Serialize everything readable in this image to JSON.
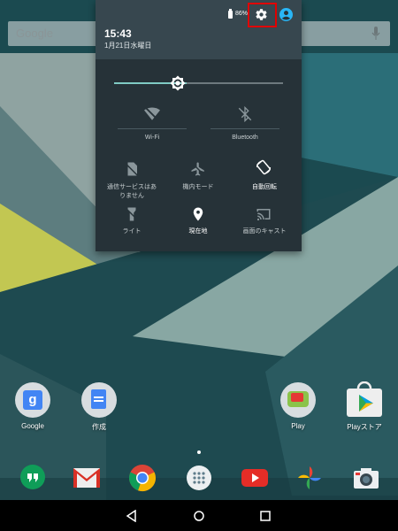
{
  "search": {
    "logo": "Google",
    "icons": {
      "mic": "microphone-icon"
    }
  },
  "status": {
    "battery_pct": "86%",
    "icons": {
      "battery": "battery-icon",
      "settings": "gear-icon",
      "user": "account-icon"
    }
  },
  "shade": {
    "time": "15:43",
    "date": "1月21日水曜日",
    "brightness_fraction": 0.43,
    "tiles": [
      {
        "label": "Wi-Fi",
        "icon": "wifi-off-icon"
      },
      {
        "label": "Bluetooth",
        "icon": "bluetooth-off-icon"
      },
      {
        "label_line1": "通信サービスはあ",
        "label_line2": "りません",
        "icon": "no-sim-icon"
      },
      {
        "label": "機内モード",
        "icon": "airplane-icon"
      },
      {
        "label": "自動回転",
        "icon": "auto-rotate-icon"
      },
      {
        "label": "ライト",
        "icon": "flashlight-icon"
      },
      {
        "label": "現在地",
        "icon": "location-icon"
      },
      {
        "label": "画面のキャスト",
        "icon": "cast-icon"
      }
    ]
  },
  "home": {
    "apps": [
      {
        "label": "Google",
        "icon": "google-folder-icon"
      },
      {
        "label": "作成",
        "icon": "docs-folder-icon"
      },
      {
        "label": "Play",
        "icon": "play-folder-icon"
      },
      {
        "label": "Playストア",
        "icon": "play-store-icon"
      }
    ],
    "dock": [
      {
        "icon": "hangouts-icon"
      },
      {
        "icon": "gmail-icon"
      },
      {
        "icon": "chrome-icon"
      },
      {
        "icon": "app-drawer-icon"
      },
      {
        "icon": "youtube-icon"
      },
      {
        "icon": "photos-icon"
      },
      {
        "icon": "camera-icon"
      }
    ]
  },
  "nav": {
    "icons": {
      "back": "back-icon",
      "home": "home-icon",
      "recents": "recents-icon"
    }
  },
  "colors": {
    "shade_bg": "#263238",
    "shade_header": "#37474f",
    "accent": "#80cbc4",
    "highlight": "#e00000"
  }
}
